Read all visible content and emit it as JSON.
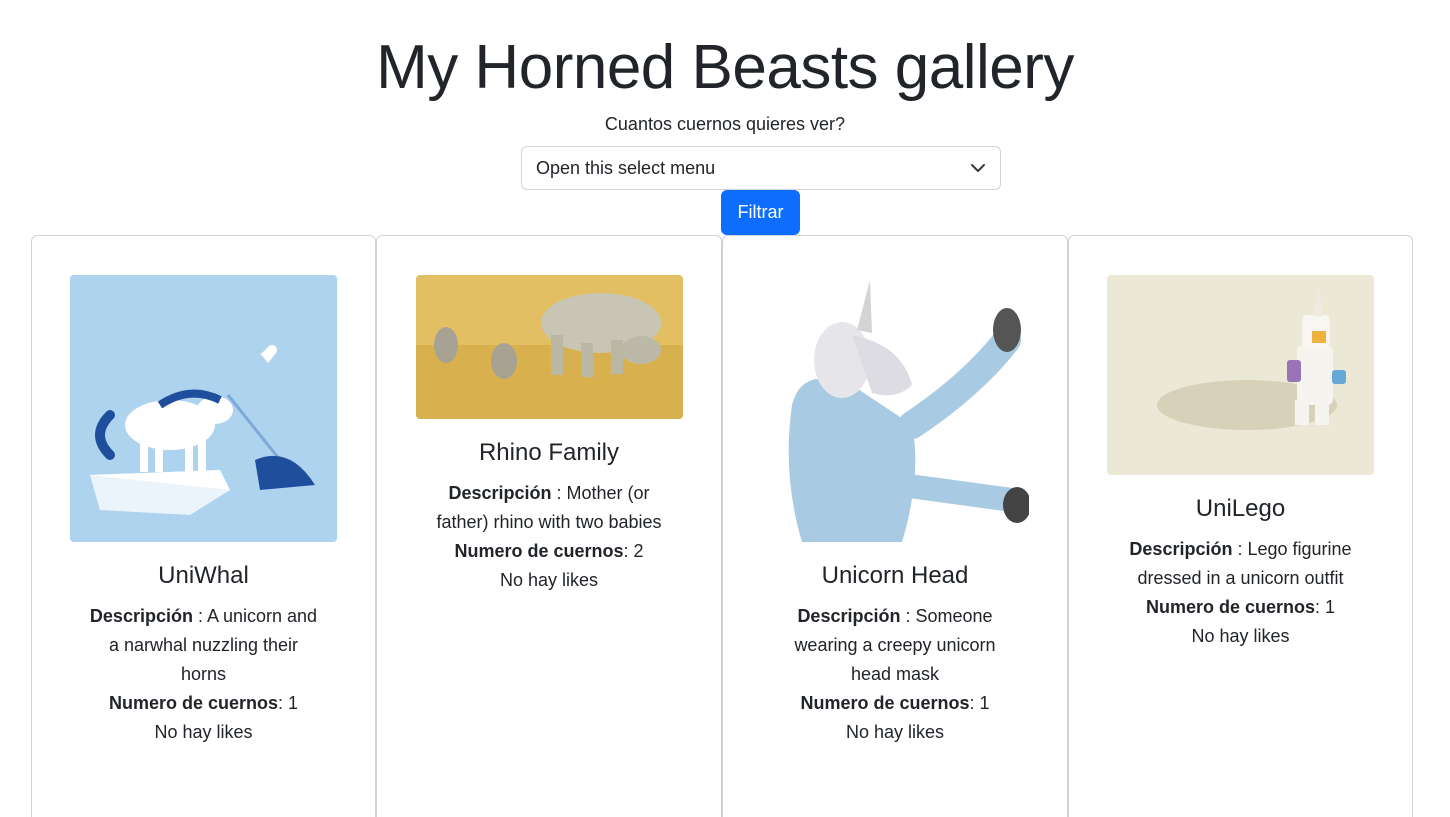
{
  "page": {
    "title": "My Horned Beasts gallery",
    "prompt": "Cuantos cuernos quieres ver?",
    "select_value": "Open this select menu",
    "button_label": "Filtrar"
  },
  "colors": {
    "primary": "#0d6efd",
    "text": "#212529",
    "border": "#d0d4d8"
  },
  "labels": {
    "desc": "Descripción",
    "horns": "Numero de cuernos"
  },
  "cards": [
    {
      "name": "UniWhal",
      "description": "A unicorn and a narwhal nuzzling their horns",
      "horns": "1",
      "likes": "No hay likes",
      "image_icon": "unicorn-narwhal-illustration"
    },
    {
      "name": "Rhino Family",
      "description": "Mother (or father) rhino with two babies",
      "horns": "2",
      "likes": "No hay likes",
      "image_icon": "rhino-photo"
    },
    {
      "name": "Unicorn Head",
      "description": "Someone wearing a creepy unicorn head mask",
      "horns": "1",
      "likes": "No hay likes",
      "image_icon": "unicorn-mask-photo"
    },
    {
      "name": "UniLego",
      "description": "Lego figurine dressed in a unicorn outfit",
      "horns": "1",
      "likes": "No hay likes",
      "image_icon": "lego-unicorn-photo"
    }
  ]
}
